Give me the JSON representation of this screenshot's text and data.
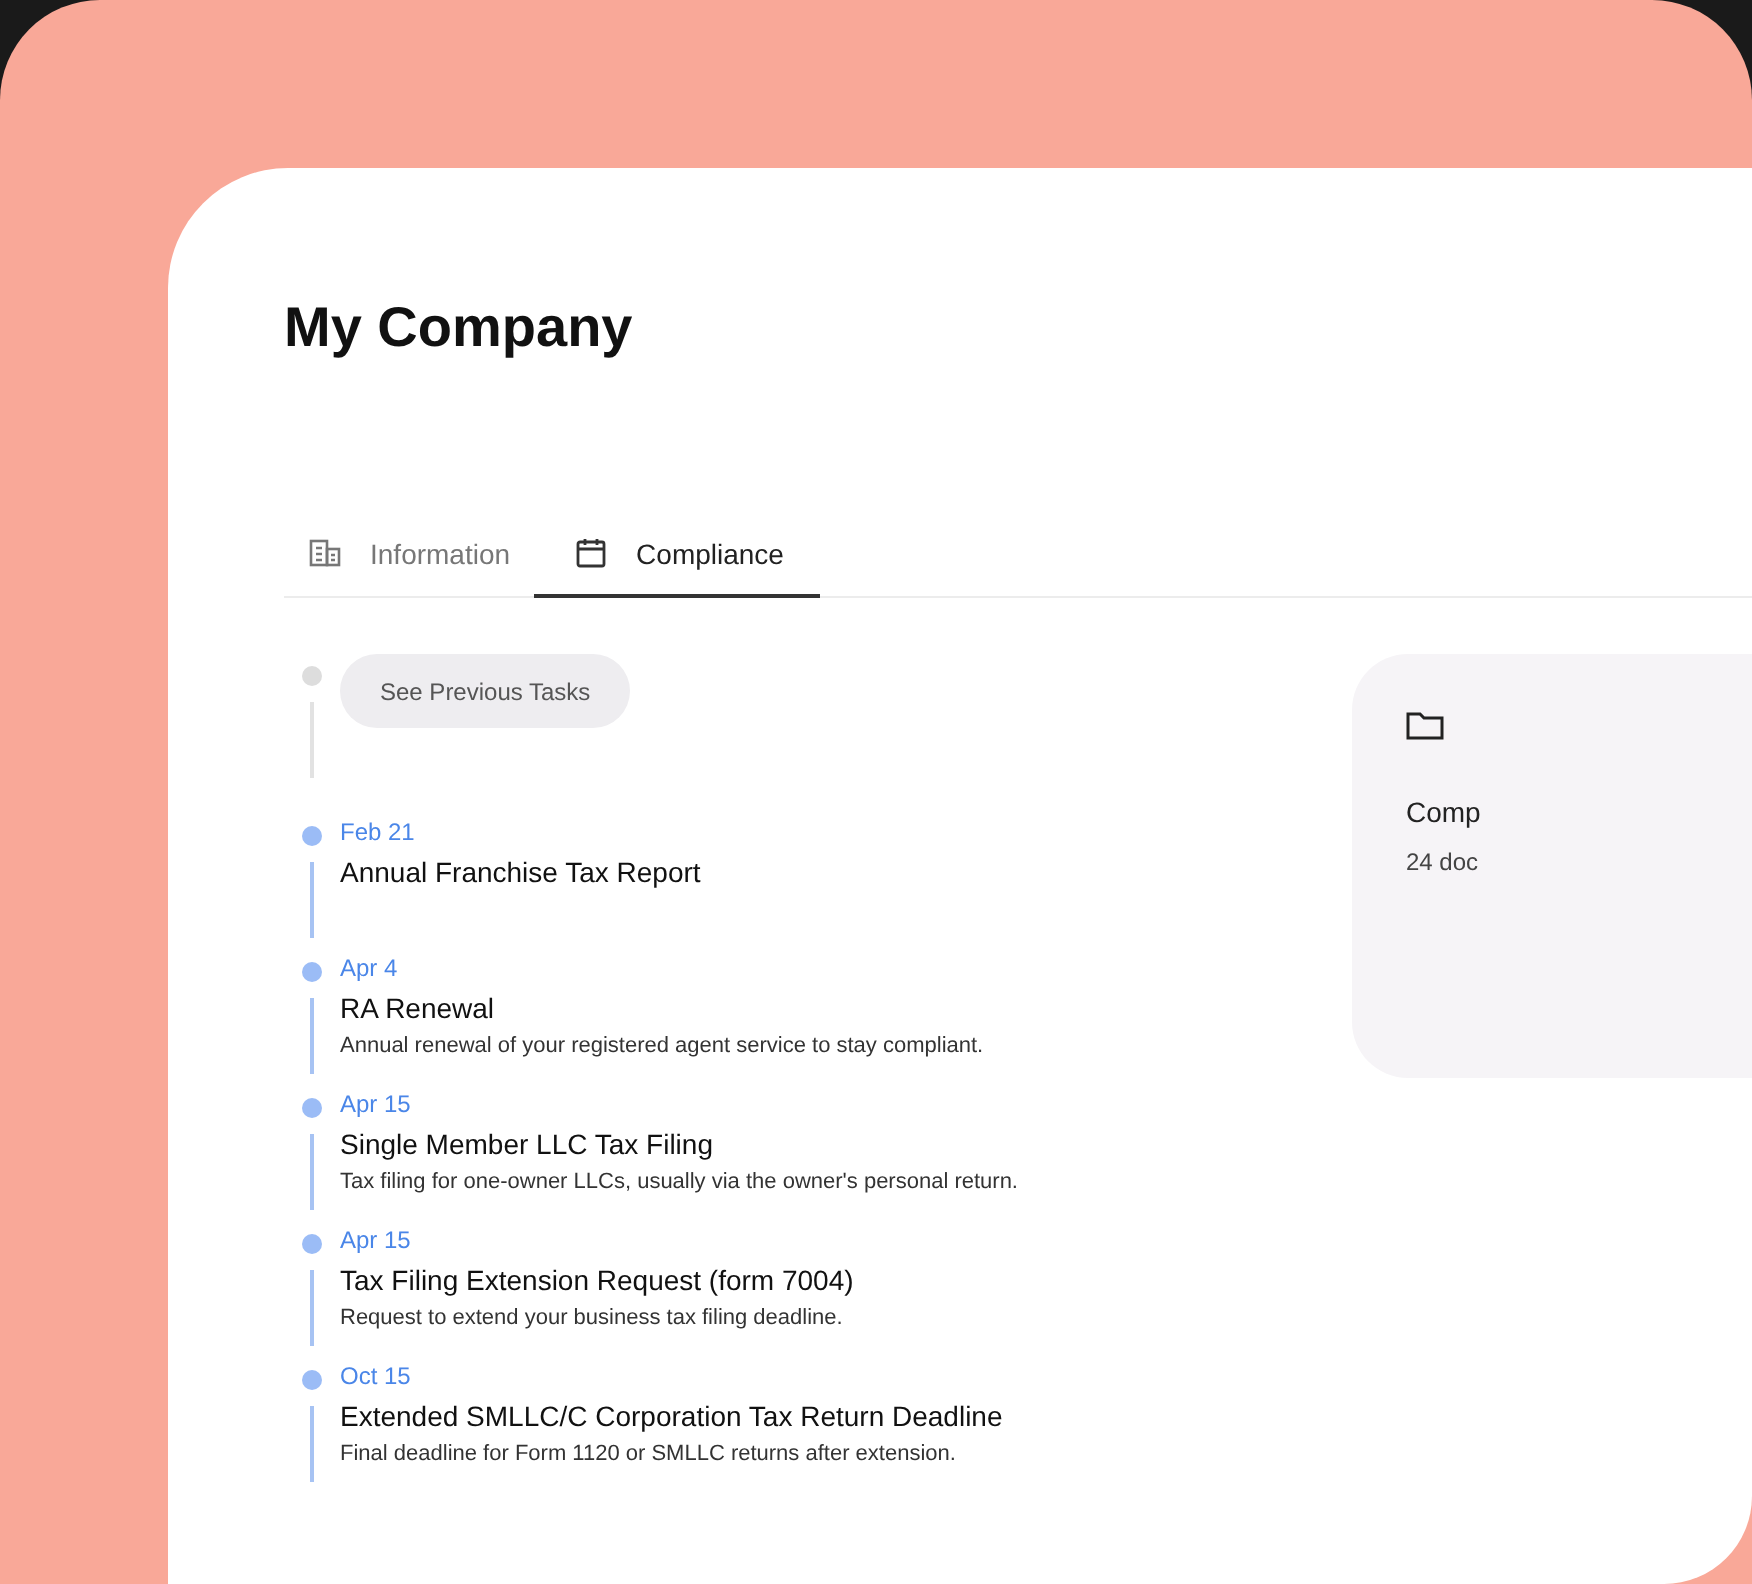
{
  "page": {
    "title": "My Company"
  },
  "tabs": [
    {
      "label": "Information",
      "kind": "building",
      "selected": false
    },
    {
      "label": "Compliance",
      "kind": "calendar",
      "selected": true
    }
  ],
  "previous_tasks_button": "See Previous Tasks",
  "tasks": [
    {
      "date": "Feb 21",
      "title": "Annual Franchise Tax Report"
    },
    {
      "date": "Apr 4",
      "title": "RA Renewal",
      "description": "Annual renewal of your registered agent service to stay compliant."
    },
    {
      "date": "Apr 15",
      "title": "Single Member LLC Tax Filing",
      "description": "Tax filing for one-owner LLCs, usually via the owner's personal return."
    },
    {
      "date": "Apr 15",
      "title": "Tax Filing Extension Request (form 7004)",
      "description": "Request to extend your business tax filing deadline."
    },
    {
      "date": "Oct 15",
      "title": "Extended SMLLC/C Corporation Tax Return Deadline",
      "description": "Final deadline for Form 1120 or SMLLC returns after extension."
    }
  ],
  "documents_card": {
    "title": "Comp",
    "subtitle": "24 doc"
  }
}
